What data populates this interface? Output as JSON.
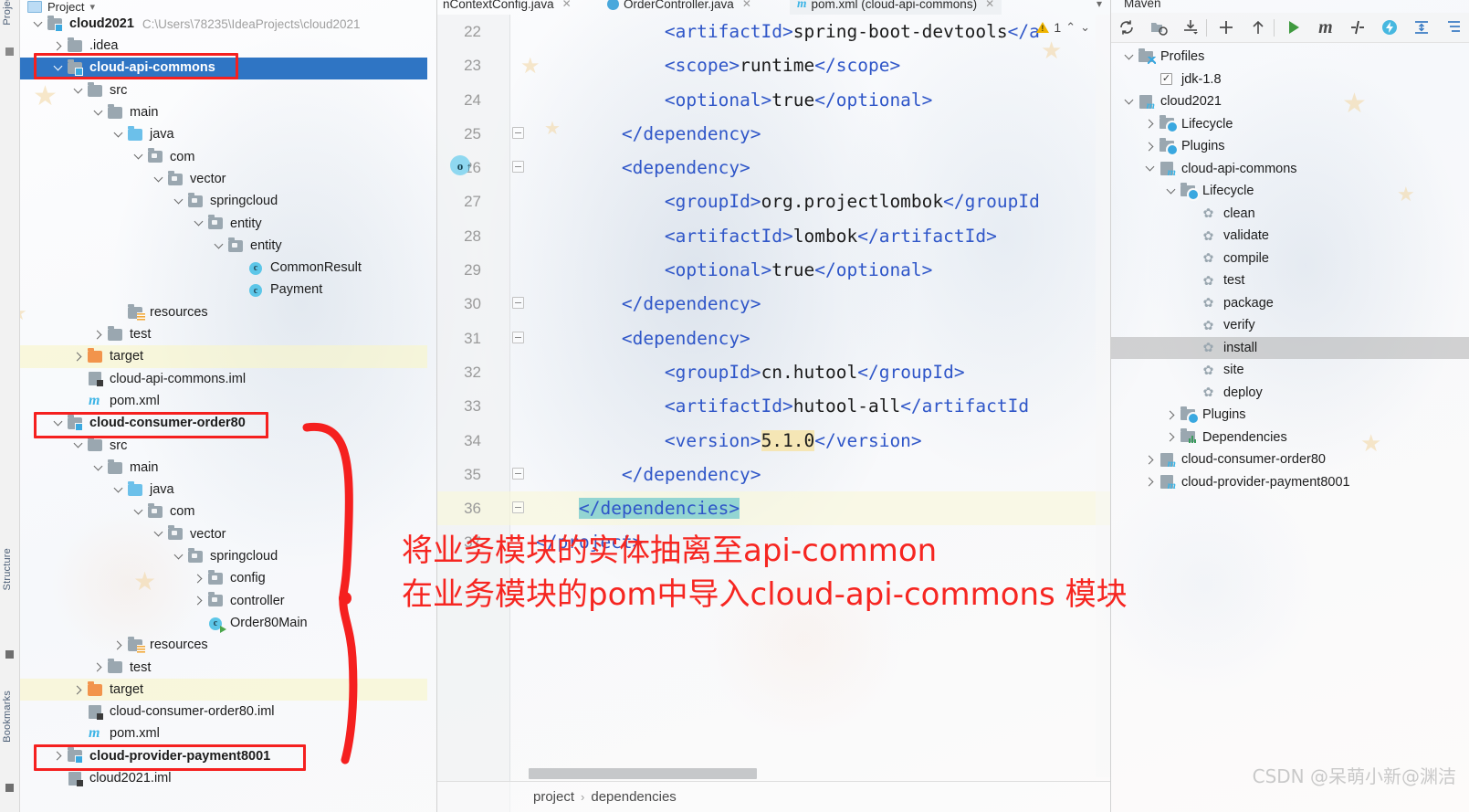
{
  "window": {
    "project_panel_title": "Project",
    "maven_panel_title": "Maven"
  },
  "left_strip": {
    "labels": [
      "Project",
      "Structure",
      "Bookmarks"
    ]
  },
  "project_tree": {
    "root": {
      "label": "cloud2021",
      "path": "C:\\Users\\78235\\IdeaProjects\\cloud2021"
    },
    "rows": [
      {
        "label": ".idea",
        "indent": 1,
        "chev": "right",
        "icon": "folder",
        "bold": false
      },
      {
        "label": "cloud-api-commons",
        "indent": 1,
        "chev": "down",
        "icon": "module",
        "bold": true,
        "selected": true
      },
      {
        "label": "src",
        "indent": 2,
        "chev": "down",
        "icon": "folder",
        "bold": false
      },
      {
        "label": "main",
        "indent": 3,
        "chev": "down",
        "icon": "folder",
        "bold": false
      },
      {
        "label": "java",
        "indent": 4,
        "chev": "down",
        "icon": "source",
        "bold": false
      },
      {
        "label": "com",
        "indent": 5,
        "chev": "down",
        "icon": "package",
        "bold": false
      },
      {
        "label": "vector",
        "indent": 6,
        "chev": "down",
        "icon": "package",
        "bold": false
      },
      {
        "label": "springcloud",
        "indent": 7,
        "chev": "down",
        "icon": "package",
        "bold": false
      },
      {
        "label": "entity",
        "indent": 8,
        "chev": "down",
        "icon": "package",
        "bold": false
      },
      {
        "label": "entity",
        "indent": 9,
        "chev": "down",
        "icon": "package",
        "bold": false
      },
      {
        "label": "CommonResult",
        "indent": 10,
        "chev": "none",
        "icon": "class",
        "bold": false
      },
      {
        "label": "Payment",
        "indent": 10,
        "chev": "none",
        "icon": "class",
        "bold": false
      },
      {
        "label": "resources",
        "indent": 4,
        "chev": "none",
        "icon": "resources",
        "bold": false
      },
      {
        "label": "test",
        "indent": 3,
        "chev": "right",
        "icon": "folder",
        "bold": false
      },
      {
        "label": "target",
        "indent": 2,
        "chev": "right",
        "icon": "target",
        "bold": false,
        "highlight": true
      },
      {
        "label": "cloud-api-commons.iml",
        "indent": 2,
        "chev": "none",
        "icon": "iml",
        "bold": false
      },
      {
        "label": "pom.xml",
        "indent": 2,
        "chev": "none",
        "icon": "pom",
        "bold": false
      },
      {
        "label": "cloud-consumer-order80",
        "indent": 1,
        "chev": "down",
        "icon": "module",
        "bold": true
      },
      {
        "label": "src",
        "indent": 2,
        "chev": "down",
        "icon": "folder",
        "bold": false
      },
      {
        "label": "main",
        "indent": 3,
        "chev": "down",
        "icon": "folder",
        "bold": false
      },
      {
        "label": "java",
        "indent": 4,
        "chev": "down",
        "icon": "source",
        "bold": false
      },
      {
        "label": "com",
        "indent": 5,
        "chev": "down",
        "icon": "package",
        "bold": false
      },
      {
        "label": "vector",
        "indent": 6,
        "chev": "down",
        "icon": "package",
        "bold": false
      },
      {
        "label": "springcloud",
        "indent": 7,
        "chev": "down",
        "icon": "package",
        "bold": false
      },
      {
        "label": "config",
        "indent": 8,
        "chev": "right",
        "icon": "package",
        "bold": false
      },
      {
        "label": "controller",
        "indent": 8,
        "chev": "right",
        "icon": "package",
        "bold": false
      },
      {
        "label": "Order80Main",
        "indent": 8,
        "chev": "none",
        "icon": "class-run",
        "bold": false
      },
      {
        "label": "resources",
        "indent": 4,
        "chev": "right",
        "icon": "resources",
        "bold": false
      },
      {
        "label": "test",
        "indent": 3,
        "chev": "right",
        "icon": "folder",
        "bold": false
      },
      {
        "label": "target",
        "indent": 2,
        "chev": "right",
        "icon": "target",
        "bold": false,
        "highlight": true
      },
      {
        "label": "cloud-consumer-order80.iml",
        "indent": 2,
        "chev": "none",
        "icon": "iml",
        "bold": false
      },
      {
        "label": "pom.xml",
        "indent": 2,
        "chev": "none",
        "icon": "pom",
        "bold": false
      },
      {
        "label": "cloud-provider-payment8001",
        "indent": 1,
        "chev": "right",
        "icon": "module",
        "bold": true
      },
      {
        "label": "cloud2021.iml",
        "indent": 1,
        "chev": "none",
        "icon": "iml",
        "bold": false
      }
    ]
  },
  "editor": {
    "tabs": [
      {
        "label": "nContextConfig.java",
        "icon": "java-class-icon",
        "active": false
      },
      {
        "label": "OrderController.java",
        "icon": "java-class-icon",
        "active": false
      },
      {
        "label": "pom.xml (cloud-api-commons)",
        "icon": "maven-file-icon",
        "active": true
      }
    ],
    "warning": {
      "count": "1"
    },
    "lines": [
      {
        "num": "22",
        "indent": 3,
        "fold": "none",
        "segments": [
          {
            "t": "<artifactId>",
            "k": "tag"
          },
          {
            "t": "spring-boot-devtools",
            "k": "txt"
          },
          {
            "t": "</a",
            "k": "tag"
          }
        ]
      },
      {
        "num": "23",
        "indent": 3,
        "fold": "none",
        "segments": [
          {
            "t": "<scope>",
            "k": "tag"
          },
          {
            "t": "runtime",
            "k": "txt"
          },
          {
            "t": "</scope>",
            "k": "tag"
          }
        ]
      },
      {
        "num": "24",
        "indent": 3,
        "fold": "none",
        "segments": [
          {
            "t": "<optional>",
            "k": "tag"
          },
          {
            "t": "true",
            "k": "txt"
          },
          {
            "t": "</optional>",
            "k": "tag"
          }
        ]
      },
      {
        "num": "25",
        "indent": 2,
        "fold": "minus",
        "segments": [
          {
            "t": "</dependency>",
            "k": "tag"
          }
        ]
      },
      {
        "num": "26",
        "indent": 2,
        "fold": "minus",
        "gutter": "maven-reimport-icon",
        "segments": [
          {
            "t": "<dependency>",
            "k": "tag"
          }
        ]
      },
      {
        "num": "27",
        "indent": 3,
        "fold": "none",
        "segments": [
          {
            "t": "<groupId>",
            "k": "tag"
          },
          {
            "t": "org.projectlombok",
            "k": "txt"
          },
          {
            "t": "</groupId",
            "k": "tag"
          }
        ]
      },
      {
        "num": "28",
        "indent": 3,
        "fold": "none",
        "segments": [
          {
            "t": "<artifactId>",
            "k": "tag"
          },
          {
            "t": "lombok",
            "k": "txt"
          },
          {
            "t": "</artifactId>",
            "k": "tag"
          }
        ]
      },
      {
        "num": "29",
        "indent": 3,
        "fold": "none",
        "segments": [
          {
            "t": "<optional>",
            "k": "tag"
          },
          {
            "t": "true",
            "k": "txt"
          },
          {
            "t": "</optional>",
            "k": "tag"
          }
        ]
      },
      {
        "num": "30",
        "indent": 2,
        "fold": "minus",
        "segments": [
          {
            "t": "</dependency>",
            "k": "tag"
          }
        ]
      },
      {
        "num": "31",
        "indent": 2,
        "fold": "minus",
        "segments": [
          {
            "t": "<dependency>",
            "k": "tag"
          }
        ]
      },
      {
        "num": "32",
        "indent": 3,
        "fold": "none",
        "segments": [
          {
            "t": "<groupId>",
            "k": "tag"
          },
          {
            "t": "cn.hutool",
            "k": "txt"
          },
          {
            "t": "</groupId>",
            "k": "tag"
          }
        ]
      },
      {
        "num": "33",
        "indent": 3,
        "fold": "none",
        "segments": [
          {
            "t": "<artifactId>",
            "k": "tag"
          },
          {
            "t": "hutool-all",
            "k": "txt"
          },
          {
            "t": "</artifactId",
            "k": "tag"
          }
        ]
      },
      {
        "num": "34",
        "indent": 3,
        "fold": "none",
        "segments": [
          {
            "t": "<version>",
            "k": "tag"
          },
          {
            "t": "5.1.0",
            "k": "mark"
          },
          {
            "t": "</version>",
            "k": "tag"
          }
        ]
      },
      {
        "num": "35",
        "indent": 2,
        "fold": "minus",
        "segments": [
          {
            "t": "</dependency>",
            "k": "tag"
          }
        ]
      },
      {
        "num": "36",
        "indent": 1,
        "fold": "minus",
        "highlight": true,
        "segments": [
          {
            "t": "</dependencies>",
            "k": "sel"
          }
        ]
      },
      {
        "num": "37",
        "indent": 0,
        "fold": "none",
        "segments": [
          {
            "t": "</project>",
            "k": "tag"
          }
        ]
      }
    ],
    "breadcrumb": [
      "project",
      "dependencies"
    ]
  },
  "maven": {
    "toolbar_icons": [
      "refresh-icon",
      "add-maven-project-icon",
      "download-sources-icon",
      "plus-icon",
      "collapse-up-icon",
      "run-icon",
      "maven-m-icon",
      "skip-tests-icon",
      "execute-goal-icon",
      "expand-icon",
      "collapse-all-icon"
    ],
    "tree": [
      {
        "label": "Profiles",
        "indent": 0,
        "chev": "down",
        "icon": "profiles"
      },
      {
        "label": "jdk-1.8",
        "indent": 1,
        "chev": "none",
        "icon": "checkbox-checked",
        "checked": true
      },
      {
        "label": "cloud2021",
        "indent": 0,
        "chev": "down",
        "icon": "maven-project"
      },
      {
        "label": "Lifecycle",
        "indent": 1,
        "chev": "right",
        "icon": "lifecycle"
      },
      {
        "label": "Plugins",
        "indent": 1,
        "chev": "right",
        "icon": "lifecycle"
      },
      {
        "label": "cloud-api-commons",
        "indent": 1,
        "chev": "down",
        "icon": "maven-project"
      },
      {
        "label": "Lifecycle",
        "indent": 2,
        "chev": "down",
        "icon": "lifecycle"
      },
      {
        "label": "clean",
        "indent": 3,
        "chev": "none",
        "icon": "goal"
      },
      {
        "label": "validate",
        "indent": 3,
        "chev": "none",
        "icon": "goal"
      },
      {
        "label": "compile",
        "indent": 3,
        "chev": "none",
        "icon": "goal"
      },
      {
        "label": "test",
        "indent": 3,
        "chev": "none",
        "icon": "goal"
      },
      {
        "label": "package",
        "indent": 3,
        "chev": "none",
        "icon": "goal"
      },
      {
        "label": "verify",
        "indent": 3,
        "chev": "none",
        "icon": "goal"
      },
      {
        "label": "install",
        "indent": 3,
        "chev": "none",
        "icon": "goal",
        "highlight": true
      },
      {
        "label": "site",
        "indent": 3,
        "chev": "none",
        "icon": "goal"
      },
      {
        "label": "deploy",
        "indent": 3,
        "chev": "none",
        "icon": "goal"
      },
      {
        "label": "Plugins",
        "indent": 2,
        "chev": "right",
        "icon": "lifecycle"
      },
      {
        "label": "Dependencies",
        "indent": 2,
        "chev": "right",
        "icon": "dependencies"
      },
      {
        "label": "cloud-consumer-order80",
        "indent": 1,
        "chev": "right",
        "icon": "maven-project"
      },
      {
        "label": "cloud-provider-payment8001",
        "indent": 1,
        "chev": "right",
        "icon": "maven-project"
      }
    ]
  },
  "annotations": {
    "line1": "将业务模块的实体抽离至api-common",
    "line2": "在业务模块的pom中导入cloud-api-commons 模块",
    "accent_color": "#f62621"
  },
  "watermark": "CSDN @呆萌小新@渊洁"
}
